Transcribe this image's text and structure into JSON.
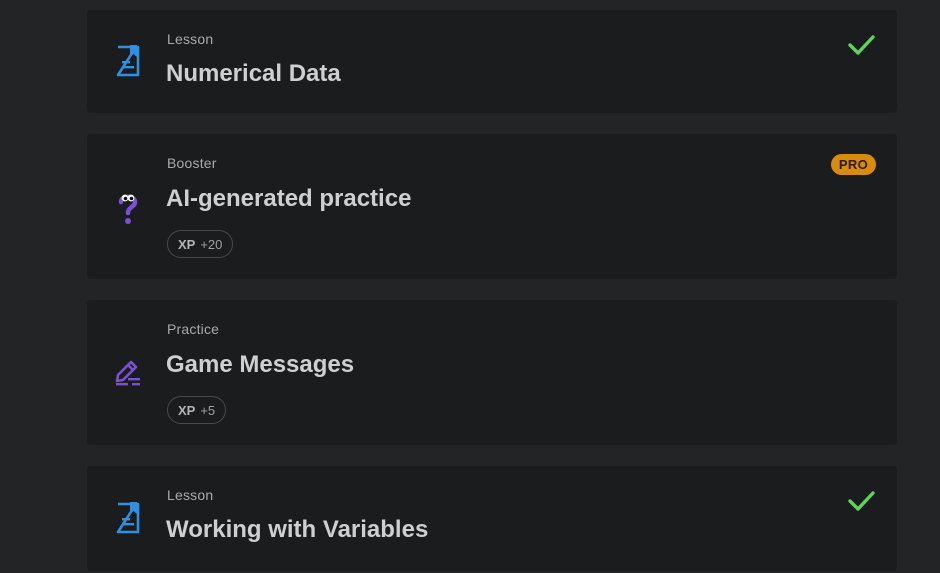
{
  "cards": [
    {
      "type": "Lesson",
      "title": "Numerical Data",
      "icon": "lesson-icon",
      "completed": true
    },
    {
      "type": "Booster",
      "title": "AI-generated practice",
      "icon": "question-mark-icon",
      "badge": "PRO",
      "xp_label": "XP",
      "xp_value": "+20"
    },
    {
      "type": "Practice",
      "title": "Game Messages",
      "icon": "pencil-icon",
      "xp_label": "XP",
      "xp_value": "+5"
    },
    {
      "type": "Lesson",
      "title": "Working with Variables",
      "icon": "lesson-icon",
      "completed": true
    }
  ],
  "colors": {
    "background": "#232426",
    "card": "#1b1c1e",
    "lesson_icon": "#2f8fe0",
    "booster_icon": "#7b4fd6",
    "check": "#5fd35a",
    "pro": "#d98b0c"
  }
}
